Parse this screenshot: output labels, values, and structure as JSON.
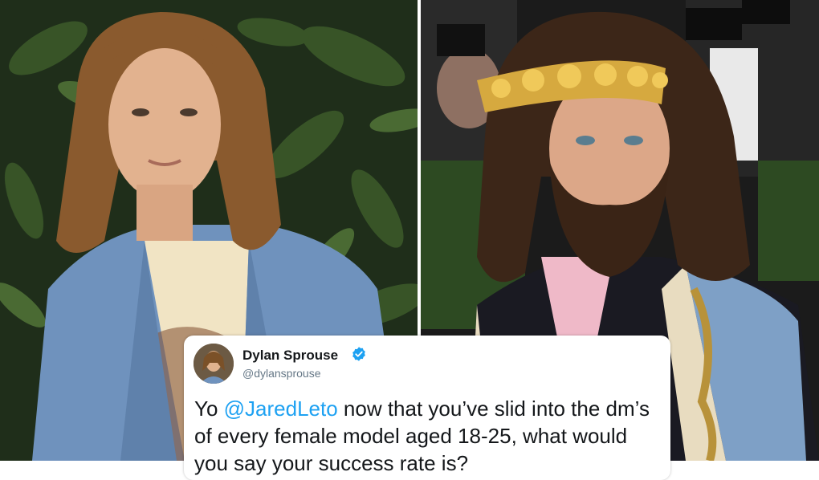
{
  "tweet": {
    "display_name": "Dylan Sprouse",
    "handle": "@dylansprouse",
    "text_start": "Yo ",
    "mention": "@JaredLeto",
    "text_rest": " now that you’ve slid into the dm’s of every female model aged 18-25, what would you say your success rate is?"
  },
  "colors": {
    "mention_blue": "#1da1f2",
    "verified_blue": "#1da1f2",
    "name_text": "#14171a",
    "handle_text": "#657786"
  },
  "icons": {
    "verified": "verified-badge-icon"
  }
}
